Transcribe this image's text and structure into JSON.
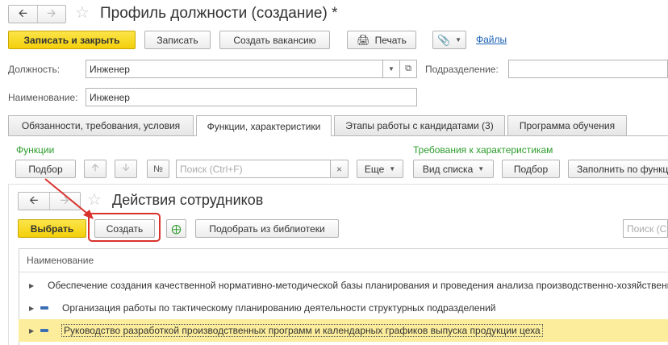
{
  "window": {
    "title": "Профиль должности (создание) *"
  },
  "toolbar": {
    "save_close": "Записать и закрыть",
    "save": "Записать",
    "create_vacancy": "Создать вакансию",
    "print": "Печать",
    "files": "Файлы"
  },
  "fields": {
    "position_label": "Должность:",
    "position_value": "Инженер",
    "department_label": "Подразделение:",
    "name_label": "Наименование:",
    "name_value": "Инженер"
  },
  "tabs": [
    {
      "label": "Обязанности, требования, условия"
    },
    {
      "label": "Функции, характеристики"
    },
    {
      "label": "Этапы работы с кандидатами (3)"
    },
    {
      "label": "Программа обучения"
    }
  ],
  "functions": {
    "header": "Функции",
    "select_btn": "Подбор",
    "search_placeholder": "Поиск (Ctrl+F)",
    "more_btn": "Еще"
  },
  "requirements": {
    "header": "Требования к характеристикам",
    "view_list": "Вид списка",
    "select_btn": "Подбор",
    "fill_btn": "Заполнить по функциям"
  },
  "dialog": {
    "title": "Действия сотрудников",
    "choose_btn": "Выбрать",
    "create_btn": "Создать",
    "library_btn": "Подобрать из библиотеки",
    "search_placeholder": "Поиск (Ctrl+F)",
    "column_header": "Наименование",
    "rows": [
      {
        "text": "Обеспечение создания качественной нормативно-методической базы планирования и проведения анализа производственно-хозяйственной деятельности"
      },
      {
        "text": "Организация работы по тактическому планированию деятельности структурных подразделений"
      },
      {
        "text": "Руководство разработкой производственных программ и календарных графиков выпуска продукции цеха"
      }
    ]
  },
  "colors": {
    "accent_yellow": "#f5d31a",
    "highlight_red": "#d9322c",
    "section_green": "#2c9c2c",
    "link_blue": "#1a5fb4"
  }
}
